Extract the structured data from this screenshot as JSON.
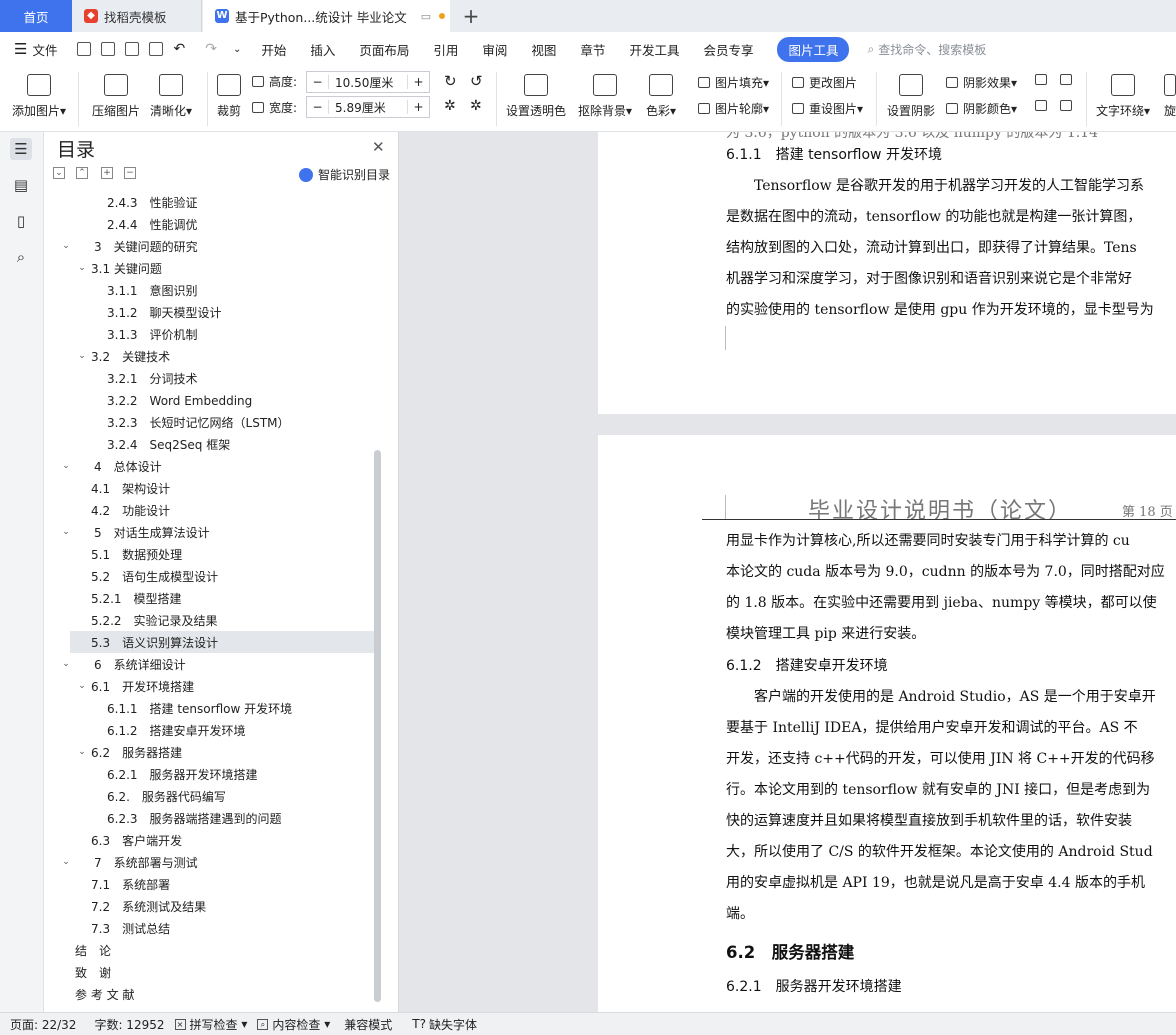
{
  "tabs": {
    "home": "首页",
    "template": "找稻壳模板",
    "document": "基于Python...统设计 毕业论文"
  },
  "menu": {
    "file": "文件",
    "items": [
      "开始",
      "插入",
      "页面布局",
      "引用",
      "审阅",
      "视图",
      "章节",
      "开发工具",
      "会员专享"
    ],
    "active": "图片工具",
    "search_placeholder": "查找命令、搜索模板"
  },
  "ribbon": {
    "add_image": "添加图片",
    "compress": "压缩图片",
    "clarify": "清晰化",
    "crop": "裁剪",
    "height_label": "高度:",
    "height_value": "10.50厘米",
    "width_label": "宽度:",
    "width_value": "5.89厘米",
    "transparent": "设置透明色",
    "remove_bg": "抠除背景",
    "color": "色彩",
    "fill": "图片填充",
    "outline": "图片轮廓",
    "change_image": "更改图片",
    "reset_image": "重设图片",
    "shadow_set": "设置阴影",
    "shadow_effect": "阴影效果",
    "shadow_color": "阴影颜色",
    "text_wrap": "文字环绕",
    "rotate": "旋"
  },
  "toc": {
    "title": "目录",
    "smart": "智能识别目录",
    "items": [
      {
        "text": "2.4.3　性能验证",
        "indent": 3,
        "arrow": ""
      },
      {
        "text": "2.4.4　性能调优",
        "indent": 3,
        "arrow": ""
      },
      {
        "text": "3　关键问题的研究",
        "indent": 1,
        "arrow": "v"
      },
      {
        "text": "3.1  关键问题",
        "indent": 2,
        "arrow": "v"
      },
      {
        "text": "3.1.1　意图识别",
        "indent": 3,
        "arrow": ""
      },
      {
        "text": "3.1.2　聊天模型设计",
        "indent": 3,
        "arrow": ""
      },
      {
        "text": "3.1.3　评价机制",
        "indent": 3,
        "arrow": ""
      },
      {
        "text": "3.2　关键技术",
        "indent": 2,
        "arrow": "v"
      },
      {
        "text": "3.2.1　分词技术",
        "indent": 3,
        "arrow": ""
      },
      {
        "text": "3.2.2　Word Embedding",
        "indent": 3,
        "arrow": ""
      },
      {
        "text": "3.2.3　长短时记忆网络（LSTM）",
        "indent": 3,
        "arrow": ""
      },
      {
        "text": "3.2.4　Seq2Seq 框架",
        "indent": 3,
        "arrow": ""
      },
      {
        "text": "4　总体设计",
        "indent": 1,
        "arrow": "v"
      },
      {
        "text": "4.1　架构设计",
        "indent": 2,
        "arrow": ""
      },
      {
        "text": "4.2　功能设计",
        "indent": 2,
        "arrow": ""
      },
      {
        "text": "5　对话生成算法设计",
        "indent": 1,
        "arrow": "v"
      },
      {
        "text": "5.1　数据预处理",
        "indent": 2,
        "arrow": ""
      },
      {
        "text": "5.2　语句生成模型设计",
        "indent": 2,
        "arrow": ""
      },
      {
        "text": "5.2.1　模型搭建",
        "indent": 2,
        "arrow": ""
      },
      {
        "text": "5.2.2　实验记录及结果",
        "indent": 2,
        "arrow": ""
      },
      {
        "text": "5.3　语义识别算法设计",
        "indent": 2,
        "arrow": "",
        "selected": true
      },
      {
        "text": "6　系统详细设计",
        "indent": 1,
        "arrow": "v"
      },
      {
        "text": "6.1　开发环境搭建",
        "indent": 2,
        "arrow": "v"
      },
      {
        "text": "6.1.1　搭建 tensorflow 开发环境",
        "indent": 3,
        "arrow": ""
      },
      {
        "text": "6.1.2　搭建安卓开发环境",
        "indent": 3,
        "arrow": ""
      },
      {
        "text": "6.2　服务器搭建",
        "indent": 2,
        "arrow": "v"
      },
      {
        "text": "6.2.1　服务器开发环境搭建",
        "indent": 3,
        "arrow": ""
      },
      {
        "text": "6.2.　服务器代码编写",
        "indent": 3,
        "arrow": ""
      },
      {
        "text": "6.2.3　服务器端搭建遇到的问题",
        "indent": 3,
        "arrow": ""
      },
      {
        "text": "6.3　客户端开发",
        "indent": 2,
        "arrow": ""
      },
      {
        "text": "7　系统部署与测试",
        "indent": 1,
        "arrow": "v"
      },
      {
        "text": "7.1　系统部署",
        "indent": 2,
        "arrow": ""
      },
      {
        "text": "7.2　系统测试及结果",
        "indent": 2,
        "arrow": ""
      },
      {
        "text": "7.3　测试总结",
        "indent": 2,
        "arrow": ""
      },
      {
        "text": "结　论",
        "indent": 0,
        "arrow": ""
      },
      {
        "text": "致　谢",
        "indent": 0,
        "arrow": ""
      },
      {
        "text": "参 考 文 献",
        "indent": 0,
        "arrow": ""
      }
    ]
  },
  "doc": {
    "page1": {
      "partial_top": "为 3.6，python 的版本为 3.6 以及 numpy 的版本为 1.14",
      "heading": "6.1.1　搭建 tensorflow 开发环境",
      "lines": [
        "　　Tensorflow 是谷歌开发的用于机器学习开发的人工智能学习系",
        "是数据在图中的流动，tensorflow 的功能也就是构建一张计算图，",
        "结构放到图的入口处，流动计算到出口，即获得了计算结果。Tens",
        "机器学习和深度学习，对于图像识别和语音识别来说它是个非常好",
        "的实验使用的 tensorflow 是使用 gpu 作为开发环境的，显卡型号为"
      ]
    },
    "page2": {
      "running_head": "毕业设计说明书（论文）",
      "page_number": "第 18 页",
      "lines": [
        "用显卡作为计算核心,所以还需要同时安装专门用于科学计算的 cu",
        "本论文的 cuda 版本号为 9.0，cudnn 的版本号为 7.0，同时搭配对应",
        "的 1.8 版本。在实验中还需要用到 jieba、numpy 等模块，都可以使",
        "模块管理工具 pip 来进行安装。"
      ],
      "heading1": "6.1.2　搭建安卓开发环境",
      "lines2": [
        "　　客户端的开发使用的是 Android Studio，AS 是一个用于安卓开",
        "要基于 IntelliJ IDEA，提供给用户安卓开发和调试的平台。AS 不",
        "开发，还支持 c++代码的开发，可以使用 JIN 将 C++开发的代码移",
        "行。本论文用到的 tensorflow 就有安卓的 JNI 接口，但是考虑到为",
        "快的运算速度并且如果将模型直接放到手机软件里的话，软件安装",
        "大，所以使用了 C/S 的软件开发框架。本论文使用的 Android Stud",
        "用的安卓虚拟机是 API 19，也就是说凡是高于安卓 4.4 版本的手机",
        "端。"
      ],
      "heading2": "6.2　服务器搭建",
      "heading3": "6.2.1　服务器开发环境搭建"
    }
  },
  "status": {
    "page": "页面: 22/32",
    "words": "字数: 12952",
    "spell": "拼写检查",
    "content": "内容检查",
    "compat": "兼容模式",
    "missing_font": "缺失字体"
  },
  "colors": {
    "accent": "#3f73ee"
  }
}
